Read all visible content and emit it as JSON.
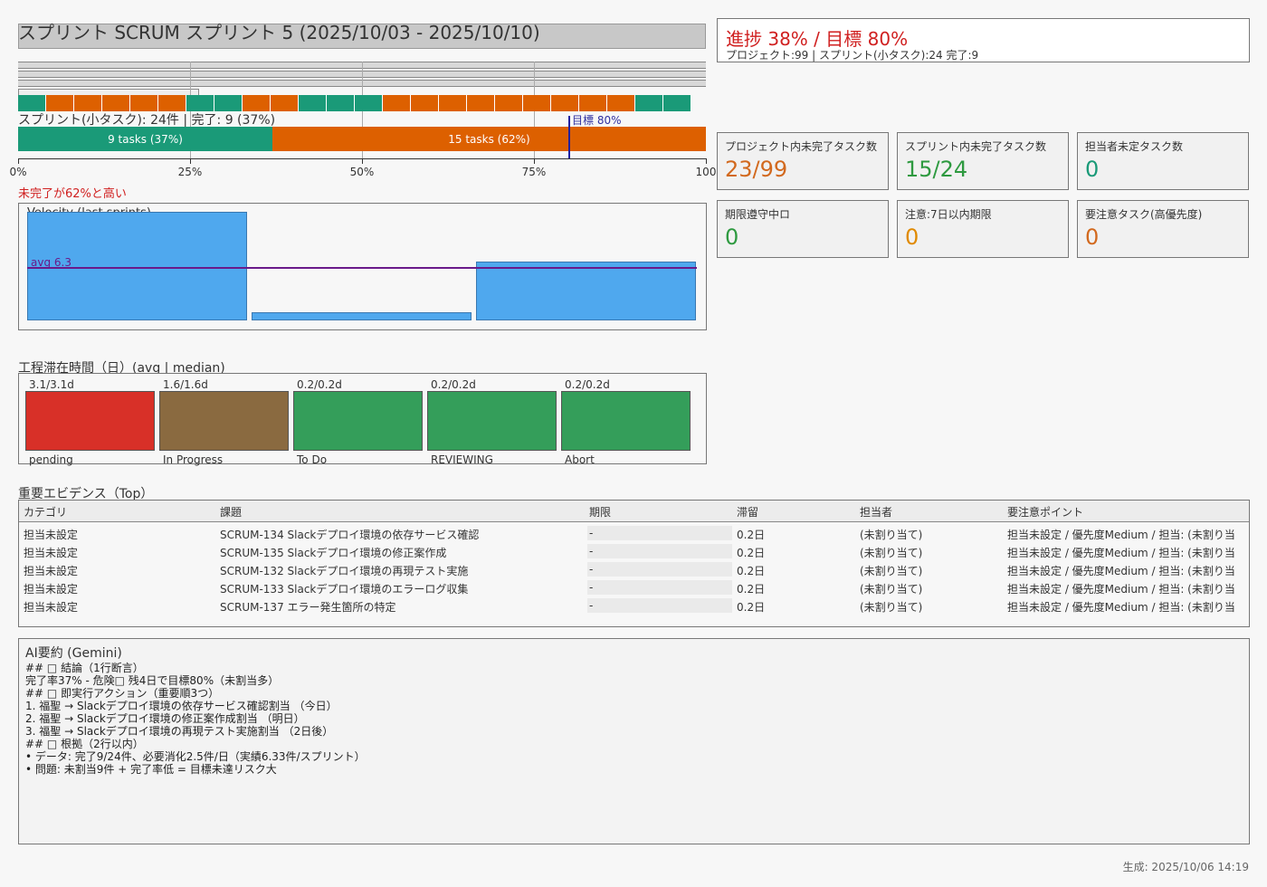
{
  "header": {
    "title": "スプリント SCRUM スプリント 5 (2025/10/03 - 2025/10/10)"
  },
  "progress": {
    "main": "進捗 38% / 目標 80%",
    "sub": "プロジェクト:99 | スプリント(小タスク):24 完了:9",
    "color": "#d02020"
  },
  "sprint_bar": {
    "label": "スプリント(小タスク): 24件 | 完了: 9 (37%)",
    "done_label": "9 tasks (37%)",
    "todo_label": "15 tasks (62%)",
    "done_fraction": 0.37,
    "target_label": "目標 80%",
    "target_fraction": 0.8,
    "done_color": "#1a9a78",
    "todo_color": "#dd6000",
    "ticks": [
      "0%",
      "25%",
      "50%",
      "75%",
      "100"
    ],
    "warning": "未完了が62%と高い"
  },
  "task_squares": [
    "done",
    "todo",
    "todo",
    "todo",
    "todo",
    "todo",
    "done",
    "done",
    "todo",
    "todo",
    "done",
    "done",
    "done",
    "todo",
    "todo",
    "todo",
    "todo",
    "todo",
    "todo",
    "todo",
    "todo",
    "todo",
    "done",
    "done"
  ],
  "velocity": {
    "title": "Velocity (last sprints)",
    "avg_label": "avg 6.3",
    "avg_value": 6.3,
    "values": [
      13,
      1,
      7
    ],
    "color": "#4fa8ee"
  },
  "stages": {
    "title": "工程滞在時間（日）(avg | median)",
    "items": [
      {
        "name": "pending",
        "value": "3.1/3.1d",
        "color": "#d83028"
      },
      {
        "name": "In Progress",
        "value": "1.6/1.6d",
        "color": "#8a6a40"
      },
      {
        "name": "To Do",
        "value": "0.2/0.2d",
        "color": "#349e5a"
      },
      {
        "name": "REVIEWING",
        "value": "0.2/0.2d",
        "color": "#349e5a"
      },
      {
        "name": "Abort",
        "value": "0.2/0.2d",
        "color": "#349e5a"
      }
    ]
  },
  "kpis": [
    {
      "label": "プロジェクト内未完了タスク数",
      "value": "23/99",
      "color": "#d2691e"
    },
    {
      "label": "スプリント内未完了タスク数",
      "value": "15/24",
      "color": "#2e9a40"
    },
    {
      "label": "担当者未定タスク数",
      "value": "0",
      "color": "#1a9a78"
    },
    {
      "label": "期限遵守中ロ",
      "value": "0",
      "color": "#2e9a40"
    },
    {
      "label": "注意:7日以内期限",
      "value": "0",
      "color": "#e08a00"
    },
    {
      "label": "要注意タスク(高優先度)",
      "value": "0",
      "color": "#d2691e"
    }
  ],
  "evidence": {
    "title": "重要エビデンス（Top）",
    "headers": [
      "カテゴリ",
      "課題",
      "期限",
      "滞留",
      "担当者",
      "要注意ポイント"
    ],
    "rows": [
      [
        "担当未設定",
        "SCRUM-134 Slackデプロイ環境の依存サービス確認",
        "-",
        "0.2日",
        "(未割り当て)",
        "担当未設定 / 優先度Medium / 担当: (未割り当"
      ],
      [
        "担当未設定",
        "SCRUM-135 Slackデプロイ環境の修正案作成",
        "-",
        "0.2日",
        "(未割り当て)",
        "担当未設定 / 優先度Medium / 担当: (未割り当"
      ],
      [
        "担当未設定",
        "SCRUM-132 Slackデプロイ環境の再現テスト実施",
        "-",
        "0.2日",
        "(未割り当て)",
        "担当未設定 / 優先度Medium / 担当: (未割り当"
      ],
      [
        "担当未設定",
        "SCRUM-133 Slackデプロイ環境のエラーログ収集",
        "-",
        "0.2日",
        "(未割り当て)",
        "担当未設定 / 優先度Medium / 担当: (未割り当"
      ],
      [
        "担当未設定",
        "SCRUM-137 エラー発生箇所の特定",
        "-",
        "0.2日",
        "(未割り当て)",
        "担当未設定 / 優先度Medium / 担当: (未割り当"
      ]
    ]
  },
  "ai_summary": {
    "title": "AI要約 (Gemini)",
    "lines": [
      "## □ 結論（1行断言）",
      "完了率37% - 危険□ 残4日で目標80%（未割当多）",
      "## □ 即実行アクション（重要順3つ）",
      "1. 福聖 → Slackデプロイ環境の依存サービス確認割当 （今日）",
      "2. 福聖 → Slackデプロイ環境の修正案作成割当 （明日）",
      "3. 福聖 → Slackデプロイ環境の再現テスト実施割当 （2日後）",
      "## □ 根拠（2行以内）",
      "• データ: 完了9/24件、必要消化2.5件/日（実績6.33件/スプリント）",
      "• 問題: 未割当9件 + 完了率低 = 目標未達リスク大"
    ]
  },
  "footer": {
    "generated": "生成: 2025/10/06 14:19"
  }
}
